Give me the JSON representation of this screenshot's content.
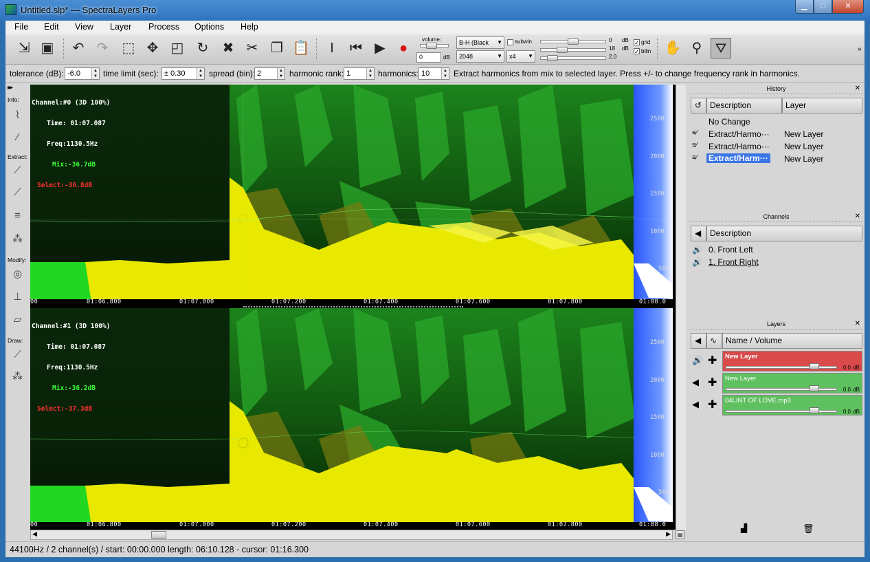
{
  "window": {
    "title": "Untitled.slp* — SpectraLayers Pro",
    "min_label": "▁",
    "max_label": "□",
    "close_label": "✕"
  },
  "menu": [
    "File",
    "Edit",
    "View",
    "Layer",
    "Process",
    "Options",
    "Help"
  ],
  "toolbar": {
    "volume_label": "volume:",
    "volume_value": "0",
    "volume_unit": "dB",
    "window_fn": "B-H (Black",
    "fft_size": "2048",
    "overlap": "x4",
    "subwin_label": "subwin",
    "grid_label": "grid",
    "bilin_label": "bilin",
    "slider1_value": "0",
    "slider2_value": "18",
    "slider3_value": "2.0",
    "unit": "dB"
  },
  "options": {
    "tolerance_label": "tolerance (dB):",
    "tolerance_value": "-6.0",
    "timelimit_label": "time limit (sec):",
    "timelimit_value": "± 0.30",
    "spread_label": "spread (bin):",
    "spread_value": "2",
    "rank_label": "harmonic rank:",
    "rank_value": "1",
    "harmonics_label": "harmonics:",
    "harmonics_value": "10",
    "hint": "Extract harmonics from mix to selected layer. Press +/- to change frequency rank in harmonics."
  },
  "left_tools": {
    "info_label": "Info:",
    "extract_label": "Extract:",
    "modify_label": "Modify:",
    "draw_label": "Draw:"
  },
  "panes": [
    {
      "channel": "Channel:#0 (3D 100%)",
      "time": "Time: 01:07.087",
      "freq": "Freq:1130.5Hz",
      "mix": "Mix:-36.7dB",
      "select": "Select:-36.8dB"
    },
    {
      "channel": "Channel:#1 (3D 100%)",
      "time": "Time: 01:07.087",
      "freq": "Freq:1130.5Hz",
      "mix": "Mix:-36.2dB",
      "select": "Select:-37.3dB"
    }
  ],
  "time_ticks": [
    "00",
    "01:06.800",
    "01:07.000",
    "01:07.200",
    "01:07.400",
    "01:07.600",
    "01:07.800",
    "01:08.0"
  ],
  "freq_ticks": [
    "2500",
    "2000",
    "1500",
    "1000",
    "500"
  ],
  "history": {
    "title": "History",
    "col_desc": "Description",
    "col_layer": "Layer",
    "rows": [
      {
        "desc": "No Change",
        "layer": ""
      },
      {
        "desc": "Extract/Harmo···",
        "layer": "New Layer"
      },
      {
        "desc": "Extract/Harmo···",
        "layer": "New Layer"
      },
      {
        "desc": "Extract/Harm···",
        "layer": "New Layer"
      }
    ]
  },
  "channels": {
    "title": "Channels",
    "col_desc": "Description",
    "rows": [
      "0. Front Left",
      "1. Front Right"
    ]
  },
  "layers": {
    "title": "Layers",
    "col_name": "Name / Volume",
    "rows": [
      {
        "name": "New Layer",
        "volume": "0.0",
        "unit": "dB",
        "color": "#d94a4a"
      },
      {
        "name": "New Layer",
        "volume": "0.0",
        "unit": "dB",
        "color": "#5fc05f"
      },
      {
        "name": "04LINT OF LOVE.mp3",
        "volume": "0.0",
        "unit": "dB",
        "color": "#5fc05f"
      }
    ]
  },
  "status": "44100Hz / 2 channel(s) / start: 00:00.000 length:  06:10.128 - cursor:  01:16.300"
}
